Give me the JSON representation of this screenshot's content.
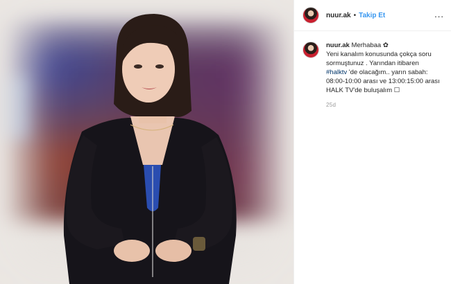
{
  "post": {
    "author": {
      "username": "nuur.ak",
      "avatar_icon": "profile-avatar"
    },
    "header": {
      "separator": "•",
      "follow_label": "Takip Et",
      "more_icon": "more-options-icon",
      "more_glyph": "..."
    },
    "caption": {
      "username": "nuur.ak",
      "greeting": "Merhabaa ✿",
      "text_part1": "Yeni kanalım konusunda çokça soru sormuştunuz . Yarından itibaren",
      "hashtag": "#halktv",
      "text_part2": " 'de olacağım.. yarın sabah: 08:00-10:00 arası ve 13:00:15:00 arası HALK TV'de buluşalım ☐",
      "timestamp": "25d"
    },
    "colors": {
      "link_blue": "#3897f0",
      "hashtag": "#003569",
      "text": "#262626",
      "muted": "#999999",
      "border": "#efefef"
    }
  }
}
